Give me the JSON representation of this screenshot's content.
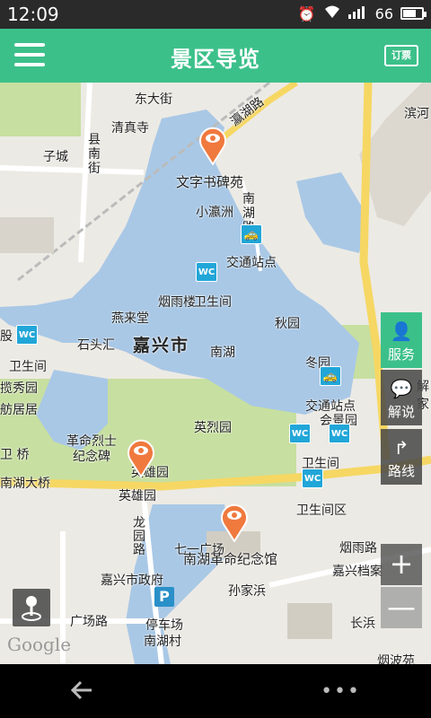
{
  "status_bar": {
    "time": "12:09",
    "battery": "66"
  },
  "app_bar": {
    "title": "景区导览",
    "ticket_label": "订票"
  },
  "map": {
    "labels": {
      "dongdajie": "东大街",
      "yingshan": "瀛湖路",
      "binhe": "滨河",
      "qingzhensi": "清真寺",
      "xiannan": "县\n南\n街",
      "zicheng": "子城",
      "wenzishubeiyuan": "文字书碑苑",
      "xiaoyingzhou": "小瀛洲",
      "nanhu_road": "南\n湖\n路",
      "jiaotong1": "交通站点",
      "yanyulou": "烟雨楼",
      "weishengjian1": "卫生间",
      "yanlaitang": "燕来堂",
      "qiuyuan": "秋园",
      "shitouhui": "石头汇",
      "jiaxing": "嘉兴市",
      "nanhu": "南湖",
      "dongyuan": "冬园",
      "gu": "股",
      "weishengjian2": "卫生间",
      "lanxiuyuan": "揽秀园",
      "fangjuju": "舫居居",
      "jiaotong2": "交通站点",
      "huijingyuan": "会景园",
      "jie": "解",
      "jia": "家",
      "yingliyuan": "英烈园",
      "geminglieshi": "革命烈士\n纪念碑",
      "yingxiongyuan1": "英雄园",
      "weishengjian3": "卫生间",
      "wei_bridge": "卫 桥",
      "nanhudaqiao": "南湖大桥",
      "yingxiongyuan2": "英雄园",
      "weishengjianqu": "卫生间区",
      "longyuanlu": "龙\n园\n路",
      "qiqilu": "七一广场",
      "nanhugeming": "南湖革命纪念馆",
      "yanyulu": "烟雨路",
      "jiaxingdangan": "嘉兴档案",
      "jiaxingzhengfu": "嘉兴市政府",
      "sunjiabang": "孙家浜",
      "guangchanglu": "广场路",
      "tingchechang": "停车场",
      "nanhucun": "南湖村",
      "changbang": "长浜",
      "yanbo": "烟波苑"
    },
    "wc_label": "WC",
    "park_label": "P",
    "google": "Google"
  },
  "side_buttons": {
    "service": "服务",
    "guide": "解说",
    "route": "路线"
  },
  "zoom": {
    "in": "+",
    "out": "—"
  },
  "colors": {
    "accent": "#3cc08a",
    "water": "#a9c8e6",
    "park": "#c7dfa0",
    "pin": "#f0793e"
  }
}
